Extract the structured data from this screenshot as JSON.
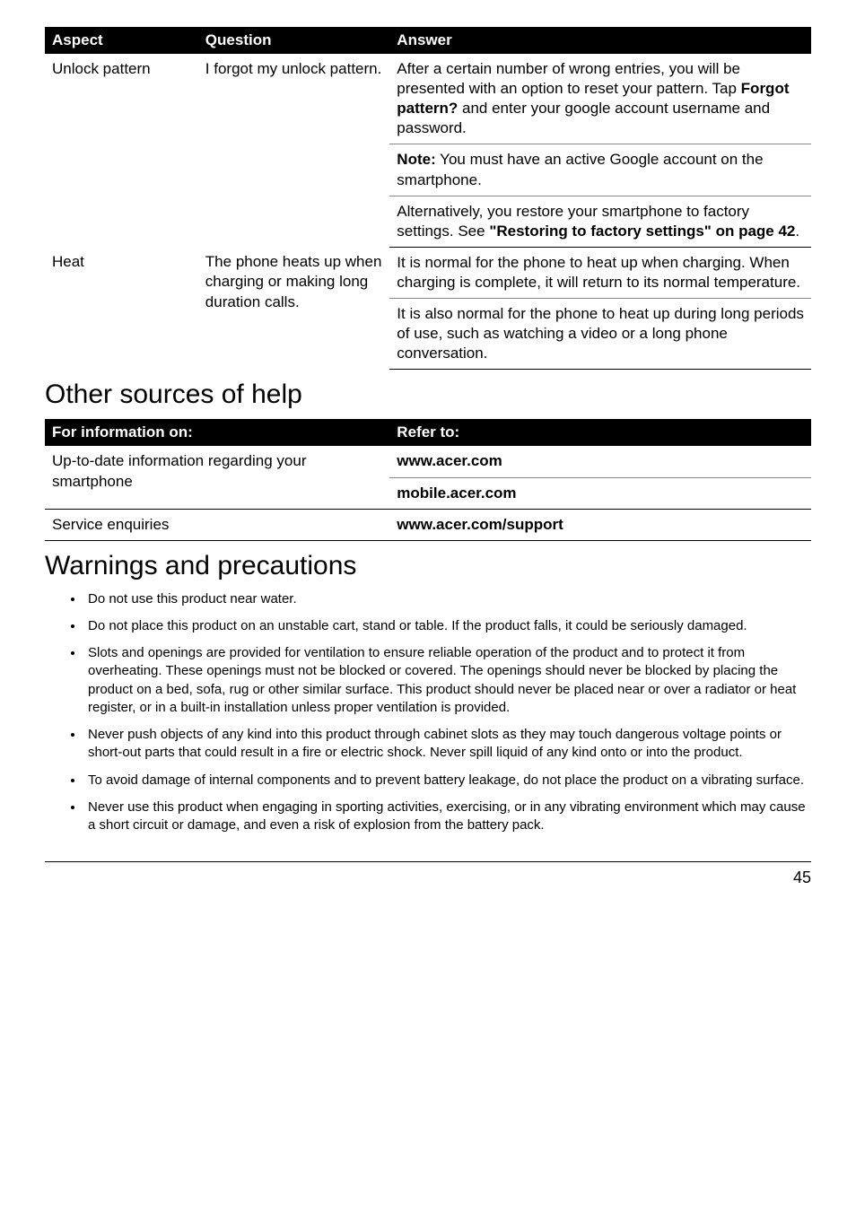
{
  "table1": {
    "headers": {
      "aspect": "Aspect",
      "question": "Question",
      "answer": "Answer"
    },
    "rows": [
      {
        "aspect": "Unlock pattern",
        "question": "I forgot my unlock pattern.",
        "answers": [
          {
            "pre": "After a certain number of wrong entries, you will be presented with an option to reset your pattern. Tap ",
            "bold": "Forgot pattern?",
            "post": " and enter your google account username and password."
          },
          {
            "pre": "",
            "bold": "Note:",
            "post": " You must have an active Google account on the smartphone."
          },
          {
            "pre": "Alternatively, you restore your smartphone to factory settings. See ",
            "bold": "\"Restoring to factory settings\" on page 42",
            "post": "."
          }
        ]
      },
      {
        "aspect": "Heat",
        "question": "The phone heats up when charging or making long duration calls.",
        "answers": [
          {
            "pre": "It is normal for the phone to heat up when charging. When charging is complete, it will return to its normal temperature.",
            "bold": "",
            "post": ""
          },
          {
            "pre": "It is also normal for the phone to heat up during long periods of use, such as watching a video or a long phone conversation.",
            "bold": "",
            "post": ""
          }
        ]
      }
    ]
  },
  "section_help": {
    "title": "Other sources of help",
    "headers": {
      "info": "For information on:",
      "refer": "Refer to:"
    },
    "rows": [
      {
        "info": "Up-to-date information regarding your smartphone",
        "refers": [
          "www.acer.com",
          "mobile.acer.com"
        ]
      },
      {
        "info": "Service enquiries",
        "refers": [
          "www.acer.com/support"
        ]
      }
    ]
  },
  "section_warn": {
    "title": "Warnings and precautions",
    "bullets": [
      "Do not use this product near water.",
      "Do not place this product on an unstable cart, stand or table. If the product falls, it could be seriously damaged.",
      "Slots and openings are provided for ventilation to ensure reliable operation of the product and to protect it from overheating. These openings must not be blocked or covered. The openings should never be blocked by placing the product on a bed, sofa, rug or other similar surface. This product should never be placed near or over a radiator or heat register, or in a built-in installation unless proper ventilation is provided.",
      "Never push objects of any kind into this product through cabinet slots as they may touch dangerous voltage points or short-out parts that could result in a fire or electric shock. Never spill liquid of any kind onto or into the product.",
      "To avoid damage of internal components and to prevent battery leakage, do not place the product on a vibrating surface.",
      "Never use this product when engaging in sporting activities, exercising, or in any vibrating environment which may cause a short circuit or damage, and even a risk of explosion from the battery pack."
    ]
  },
  "page_number": "45"
}
